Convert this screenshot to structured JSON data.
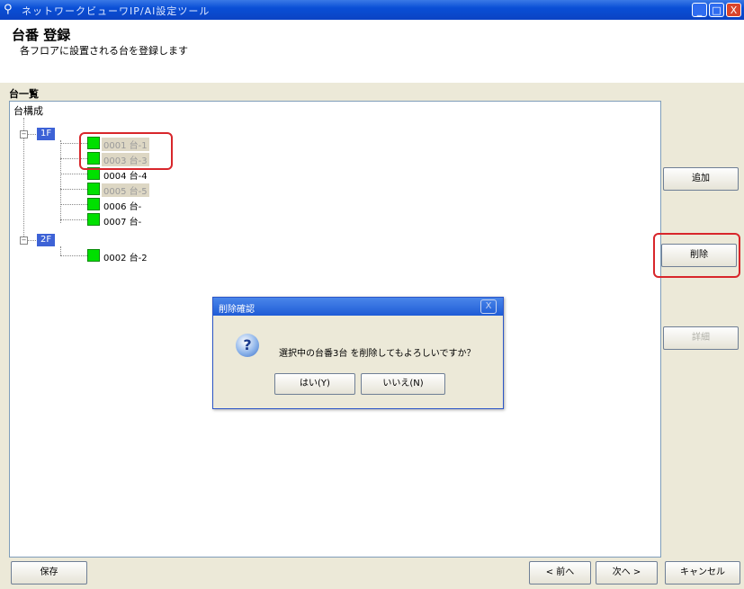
{
  "window": {
    "title": "ネットワークビューワIP/AI設定ツール",
    "controls": [
      "_",
      "□",
      "X"
    ]
  },
  "header": {
    "title": "台番 登録",
    "subtitle": "各フロアに設置される台を登録します"
  },
  "list": {
    "label": "台一覧",
    "root": "台構成",
    "floors": [
      {
        "name": "1F",
        "items": [
          {
            "label": "0001 台-1",
            "selected": true
          },
          {
            "label": "0003 台-3",
            "selected": true
          },
          {
            "label": "0004 台-4",
            "selected": false
          },
          {
            "label": "0005 台-5",
            "selected": true
          },
          {
            "label": "0006 台-",
            "selected": false
          },
          {
            "label": "0007 台-",
            "selected": false
          }
        ]
      },
      {
        "name": "2F",
        "items": [
          {
            "label": "0002 台-2",
            "selected": false
          }
        ]
      }
    ]
  },
  "side_buttons": {
    "add": "追加",
    "delete": "削除",
    "detail": "詳細"
  },
  "dialog": {
    "title": "削除確認",
    "close": "X",
    "message": "選択中の台番3台 を削除してもよろしいですか？",
    "yes": "はい(Y)",
    "no": "いいえ(N)"
  },
  "footer": {
    "save": "保存",
    "prev": "< 前へ",
    "next": "次へ >",
    "cancel": "キャンセル"
  },
  "colors": {
    "titlebar": "#0a4fd6",
    "floor_tag": "#3d62d6",
    "node_square": "#00e000",
    "highlight_box": "#d8262b"
  }
}
